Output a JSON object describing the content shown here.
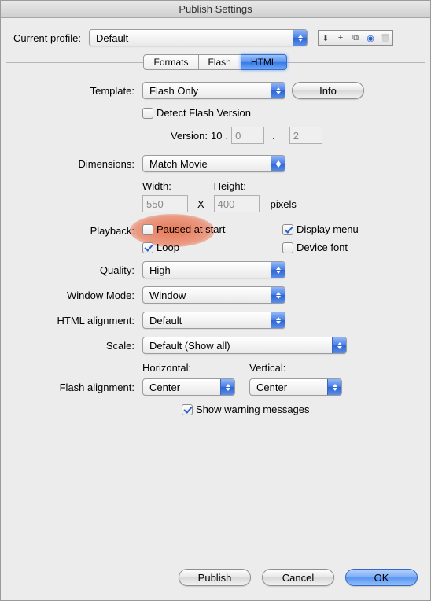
{
  "title": "Publish Settings",
  "profile": {
    "label": "Current profile:",
    "value": "Default"
  },
  "tabs": [
    "Formats",
    "Flash",
    "HTML"
  ],
  "template": {
    "label": "Template:",
    "value": "Flash Only",
    "info_btn": "Info"
  },
  "detect_flash": {
    "label": "Detect Flash Version",
    "version_label": "Version:",
    "major": "10",
    "minor": "0",
    "rev": "2"
  },
  "dimensions": {
    "label": "Dimensions:",
    "value": "Match Movie",
    "width_label": "Width:",
    "height_label": "Height:",
    "width": "550",
    "height": "400",
    "x": "X",
    "px": "pixels"
  },
  "playback": {
    "label": "Playback:",
    "paused": "Paused at start",
    "loop": "Loop",
    "display_menu": "Display menu",
    "device_font": "Device font"
  },
  "quality": {
    "label": "Quality:",
    "value": "High"
  },
  "window_mode": {
    "label": "Window Mode:",
    "value": "Window"
  },
  "html_align": {
    "label": "HTML alignment:",
    "value": "Default"
  },
  "scale": {
    "label": "Scale:",
    "value": "Default (Show all)"
  },
  "flash_align": {
    "label": "Flash alignment:",
    "h_label": "Horizontal:",
    "v_label": "Vertical:",
    "h_value": "Center",
    "v_value": "Center"
  },
  "show_warnings": "Show warning messages",
  "buttons": {
    "publish": "Publish",
    "cancel": "Cancel",
    "ok": "OK"
  },
  "icons": {
    "import": "⬇",
    "add": "+",
    "duplicate": "⧉",
    "rename": "◉",
    "delete": "🗑"
  }
}
